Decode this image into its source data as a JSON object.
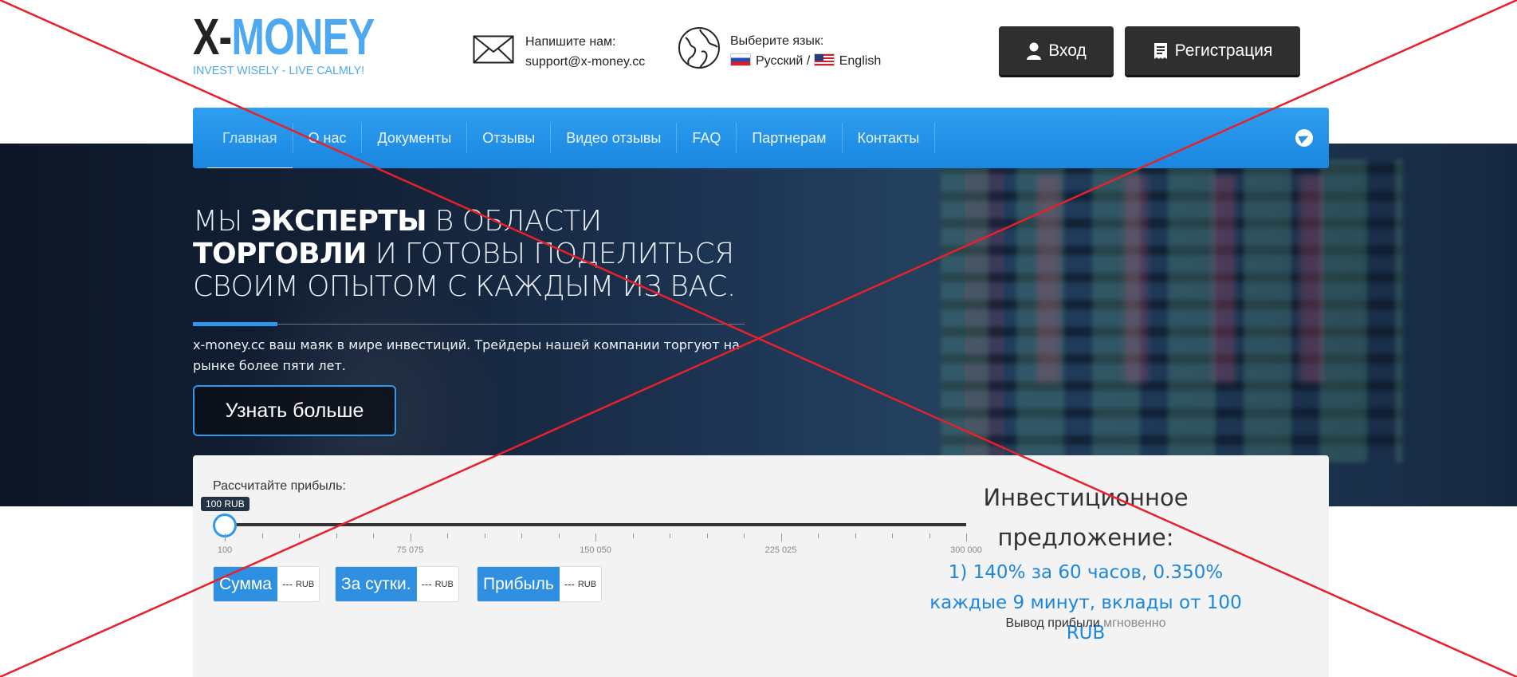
{
  "logo": {
    "part1": "X-",
    "part2": "MONEY",
    "tagline": "INVEST WISELY - LIVE CALMLY!"
  },
  "contact": {
    "label": "Напишите нам:",
    "email": "support@x-money.cc"
  },
  "language": {
    "label": "Выберите язык:",
    "ru": "Русский",
    "separator": "/",
    "en": "English"
  },
  "auth": {
    "login": "Вход",
    "register": "Регистрация"
  },
  "nav": {
    "items": [
      "Главная",
      "О нас",
      "Документы",
      "Отзывы",
      "Видео отзывы",
      "FAQ",
      "Партнерам",
      "Контакты"
    ]
  },
  "hero": {
    "t1": "МЫ ",
    "t2": "ЭКСПЕРТЫ",
    "t3": " В ОБЛАСТИ ",
    "t4": "ТОРГОВЛИ",
    "t5": " И ГОТОВЫ ПОДЕЛИТЬСЯ СВОИМ ОПЫТОМ С КАЖДЫМ ИЗ ВАС.",
    "description": "x-money.cc ваш маяк в мире инвестиций. Трейдеры нашей компании торгуют на рынке более пяти лет.",
    "cta": "Узнать больше"
  },
  "calculator": {
    "label": "Рассчитайте прибыль:",
    "slider_tip": "100 RUB",
    "slider_value_fraction": 0,
    "ticks": [
      "100",
      "75 075",
      "150 050",
      "225 025",
      "300 000"
    ],
    "boxes": [
      {
        "caption": "Сумма",
        "value": "---",
        "unit": "RUB"
      },
      {
        "caption": "За сутки.",
        "value": "---",
        "unit": "RUB"
      },
      {
        "caption": "Прибыль",
        "value": "---",
        "unit": "RUB"
      }
    ]
  },
  "offer": {
    "title": "Инвестиционное предложение:",
    "description": "1) 140% за 60 часов, 0.350% каждые 9 минут, вклады от 100 RUB",
    "note_prefix": "Вывод прибыли",
    "note_highlight": "мгновенно"
  },
  "colors": {
    "accent": "#2e98ec",
    "overlay_cross": "#e8202a",
    "dark_button": "#2f2f2f"
  },
  "icons": {
    "mail": "mail-icon",
    "globe": "globe-icon",
    "user": "user-icon",
    "register": "register-icon",
    "telegram": "telegram-icon"
  }
}
